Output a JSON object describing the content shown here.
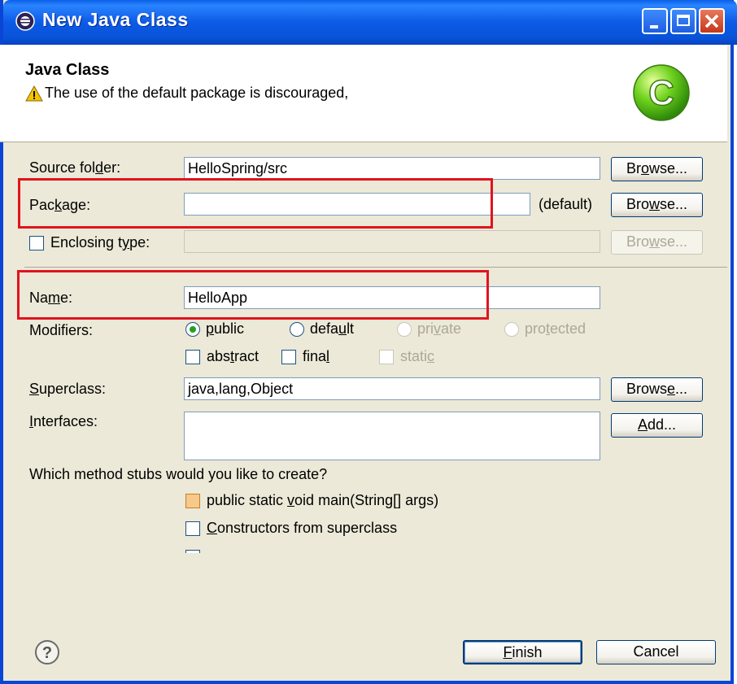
{
  "window": {
    "title": "New Java Class",
    "icon": "eclipse-icon",
    "controls": [
      "minimize-icon",
      "maximize-icon",
      "close-icon"
    ],
    "title_bar_color": "#0a5fe8"
  },
  "banner": {
    "title": "Java Class",
    "warning_message": "The use of the default package is discouraged,",
    "logo": "java-class-logo-icon"
  },
  "form": {
    "source_folder": {
      "label": "Source folder:",
      "value": "HelloSpring/src",
      "button": "Browse..."
    },
    "package": {
      "label": "Package:",
      "value": "",
      "suffix": "(default)",
      "button": "Browse..."
    },
    "enclosing_type": {
      "label": "Enclosing type:",
      "checked": false,
      "value": "",
      "button": "Browse..."
    },
    "name": {
      "label": "Name:",
      "value": "HelloApp"
    },
    "modifiers": {
      "label": "Modifiers:",
      "radios": [
        {
          "label": "public",
          "checked": true,
          "enabled": true
        },
        {
          "label": "default",
          "checked": false,
          "enabled": true
        },
        {
          "label": "private",
          "checked": false,
          "enabled": false
        },
        {
          "label": "protected",
          "checked": false,
          "enabled": false
        }
      ],
      "checkboxes": [
        {
          "label": "abstract",
          "checked": false,
          "enabled": true
        },
        {
          "label": "final",
          "checked": false,
          "enabled": true
        },
        {
          "label": "static",
          "checked": false,
          "enabled": false
        }
      ]
    },
    "superclass": {
      "label": "Superclass:",
      "value": "java,lang,Object",
      "button": "Browse..."
    },
    "interfaces": {
      "label": "Interfaces:",
      "button": "Add..."
    },
    "stubs": {
      "question": "Which method stubs would you like to create?",
      "options": [
        {
          "label": "public static void main(String[] args)",
          "checked": false
        },
        {
          "label": "Constructors from superclass",
          "checked": false
        }
      ]
    }
  },
  "footer": {
    "help_icon": "help-icon",
    "finish_label": "Finish",
    "cancel_label": "Cancel"
  },
  "highlight_color": "#e0141e"
}
